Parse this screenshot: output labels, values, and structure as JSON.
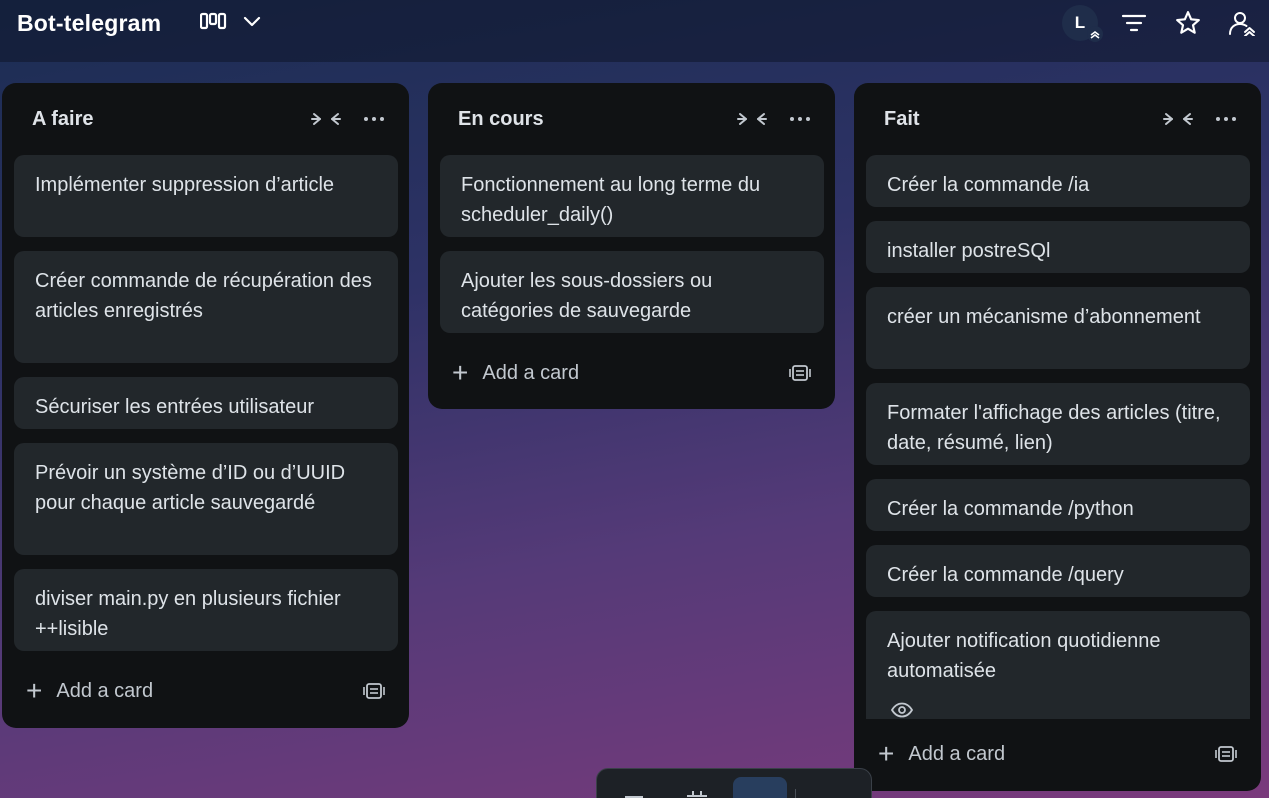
{
  "board": {
    "title": "Bot-telegram",
    "accent_color": "#283e5e",
    "avatar_initial": "L"
  },
  "header_icons": [
    "board-view-icon",
    "chevron-down-icon",
    "filter-icon",
    "star-icon",
    "share-icon"
  ],
  "lists": [
    {
      "title": "A faire",
      "cards": [
        "Implémenter suppression d’article",
        "Créer commande de récupération des articles enregistrés",
        "Sécuriser les entrées utilisateur",
        "Prévoir un système d’ID ou d’UUID pour chaque article sauvegardé",
        "diviser main.py en plusieurs fichier ++lisible"
      ],
      "add_label": "Add a card"
    },
    {
      "title": "En cours",
      "cards": [
        "Fonctionnement au long terme du scheduler_daily()",
        "Ajouter les sous-dossiers ou catégories de sauvegarde"
      ],
      "add_label": "Add a card"
    },
    {
      "title": "Fait",
      "cards": [
        "Créer la commande /ia",
        "installer postreSQl",
        "créer un mécanisme d’abonnement",
        "Formater l'affichage des articles (titre, date, résumé, lien)",
        "Créer la commande /python",
        "Créer la commande /query",
        "Ajouter notification quotidienne automatisée"
      ],
      "add_label": "Add a card"
    }
  ]
}
